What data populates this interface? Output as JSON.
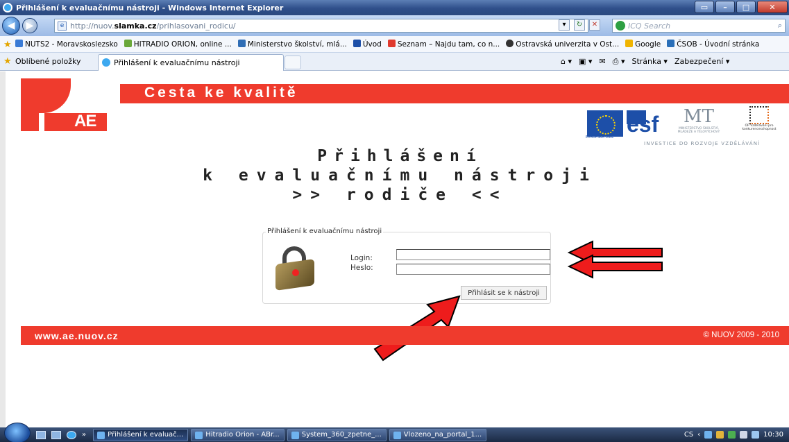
{
  "window": {
    "title": "Přihlášení k evaluačnímu nástroji - Windows Internet Explorer"
  },
  "address": {
    "url_prefix": "http://nuov.",
    "url_domain": "slamka.cz",
    "url_path": "/prihlasovani_rodicu/",
    "search_placeholder": "ICQ Search"
  },
  "favorites": [
    "NUTS2 - Moravskoslezsko",
    "HITRADIO ORION, online ...",
    "Ministerstvo školství, mlá...",
    "Úvod",
    "Seznam – Najdu tam, co n...",
    "Ostravská univerzita v Ost...",
    "Google",
    "ČSOB - Úvodní stránka"
  ],
  "tabs": {
    "favorites_label": "Oblíbené položky",
    "active_tab": "Přihlášení k evaluačnímu nástroji",
    "page_menu": "Stránka ▾",
    "security_menu": "Zabezpečení ▾"
  },
  "page": {
    "logo_text": "AE",
    "slogan": "Cesta ke kvalitě",
    "eu_caption": "EVROPSKÁ UNIE",
    "msmt_caption": "MINISTERSTVO ŠKOLSTVÍ, MLÁDEŽE A TĚLOVÝCHOVY",
    "op_caption": "OP Vzdělávání pro konkurenceschopnost",
    "investice": "INVESTICE DO ROZVOJE VZDĚLÁVÁNÍ",
    "heading_line1": "Přihlášení",
    "heading_line2": "k evaluačnímu nástroji",
    "heading_line3": ">> rodiče <<",
    "login": {
      "legend": "Přihlášení k evaluačnímu nástroji",
      "login_label": "Login:",
      "login_value": "",
      "password_label": "Heslo:",
      "password_value": "",
      "submit_label": "Přihlásit se k nástroji"
    },
    "footer_url": "www.ae.nuov.cz",
    "footer_copyright": "© NUOV 2009 - 2010",
    "accent_color": "#ef3b2d"
  },
  "taskbar": {
    "tasks": [
      "Přihlášení k evaluač...",
      "Hitradio Orion - ABr...",
      "System_360_zpetne_...",
      "Vlozeno_na_portal_1..."
    ],
    "language": "CS",
    "time": "10:30"
  }
}
